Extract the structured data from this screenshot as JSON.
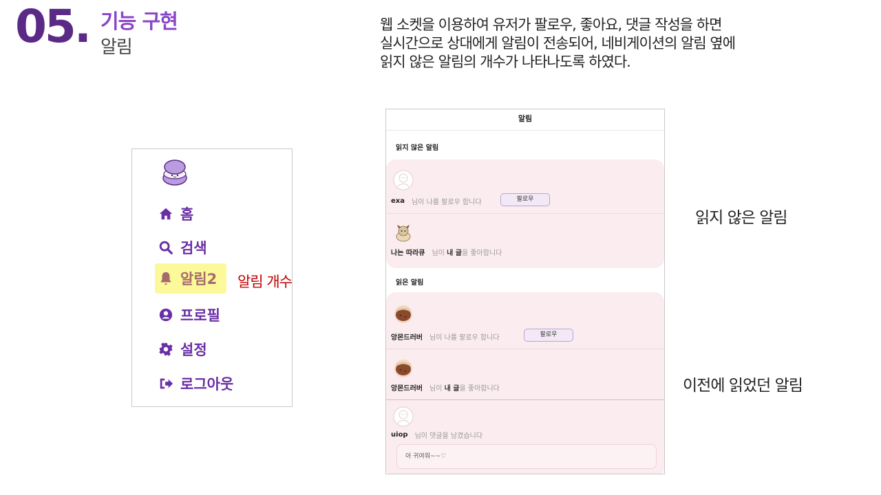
{
  "header": {
    "number": "05.",
    "title": "기능 구현",
    "subtitle": "알림"
  },
  "description": [
    "웹 소켓을 이용하여 유저가 팔로우, 좋아요, 댓글 작성을 하면",
    "실시간으로 상대에게 알림이 전송되어, 네비게이션의 알림 옆에",
    "읽지 않은 알림의 개수가 나타나도록 하였다."
  ],
  "nav": {
    "items": [
      {
        "label": "홈",
        "icon": "home-icon"
      },
      {
        "label": "검색",
        "icon": "search-icon"
      },
      {
        "label": "알림2",
        "icon": "bell-icon"
      },
      {
        "label": "프로필",
        "icon": "user-circle-icon"
      },
      {
        "label": "설정",
        "icon": "gear-icon"
      },
      {
        "label": "로그아웃",
        "icon": "logout-icon"
      }
    ],
    "annotation": "알림 개수",
    "highlight_color": "#fbf99a",
    "accent_color": "#6a2ea6"
  },
  "notifications": {
    "title": "알림",
    "unread_label": "읽지 않은 알림",
    "read_label": "읽은 알림",
    "unread": [
      {
        "nick": "exa",
        "message": "님이 나를 팔로우 합니다",
        "button": "팔로우",
        "avatar": "default-avatar-icon"
      },
      {
        "nick": "나는 따라큐",
        "message_pre": "님이 ",
        "message_bold": "내 글",
        "message_post": "을 좋아합니다",
        "avatar": "character-avatar-icon"
      }
    ],
    "read": [
      {
        "nick": "앙몬드러버",
        "message": "님이 나를 팔로우 합니다",
        "button": "팔로우",
        "avatar": "cookie-avatar-icon"
      },
      {
        "nick": "앙몬드러버",
        "message_pre": "님이 ",
        "message_bold": "내 글",
        "message_post": "을 좋아합니다",
        "avatar": "cookie-avatar-icon"
      },
      {
        "nick": "uiop",
        "message": "님이 댓글을 남겼습니다",
        "comment": "아 귀여워~~♡",
        "avatar": "default-avatar-icon"
      }
    ],
    "card_color": "#fbecef"
  },
  "annotations": {
    "unread": "읽지 않은 알림",
    "read": "이전에 읽었던 알림"
  }
}
